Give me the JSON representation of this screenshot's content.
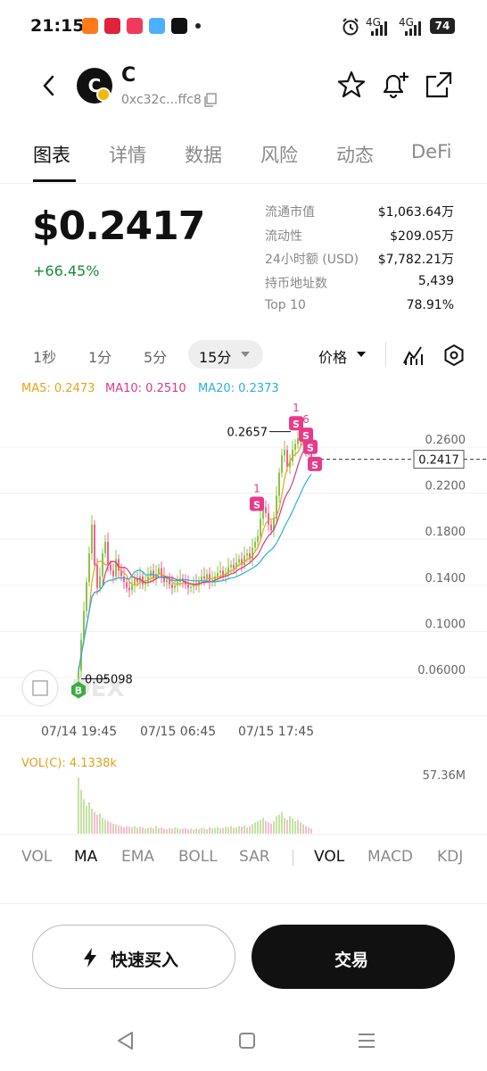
{
  "status_bar": {
    "time": "21:15",
    "network_1": "4G",
    "network_2": "4G",
    "battery": "74",
    "app_icons": [
      {
        "name": "app-icon-1",
        "color": "#ff7a1a"
      },
      {
        "name": "app-icon-2",
        "color": "#e0223a"
      },
      {
        "name": "app-icon-3",
        "color": "#f03a5a"
      },
      {
        "name": "app-icon-4",
        "color": "#4db0ff"
      },
      {
        "name": "tiktok-icon",
        "color": "#111111"
      }
    ]
  },
  "header": {
    "token_symbol": "C",
    "token_initial": "C",
    "address": "0xc32c...ffc8"
  },
  "tabs": [
    "图表",
    "详情",
    "数据",
    "风险",
    "动态",
    "DeFi"
  ],
  "price": {
    "value": "$0.2417",
    "change": "+66.45%",
    "change_color": "#1a8a3a"
  },
  "stats": [
    {
      "label": "流通市值",
      "value": "$1,063.64万"
    },
    {
      "label": "流动性",
      "value": "$209.05万"
    },
    {
      "label": "24小时额 (USD)",
      "value": "$7,782.21万"
    },
    {
      "label": "持币地址数",
      "value": "5,439"
    },
    {
      "label": "Top 10",
      "value": "78.91%"
    }
  ],
  "intervals": [
    "1秒",
    "1分",
    "5分"
  ],
  "active_interval": "15分",
  "price_type": "价格",
  "ma_legend": [
    {
      "label": "MA5: 0.2473",
      "color": "#e8a317"
    },
    {
      "label": "MA10: 0.2510",
      "color": "#d63a8a"
    },
    {
      "label": "MA20: 0.2373",
      "color": "#2bb0d8"
    }
  ],
  "chart_data": {
    "type": "candlestick",
    "y_ticks": [
      "0.2600",
      "0.2200",
      "0.1800",
      "0.1400",
      "0.1000",
      "0.06000"
    ],
    "y_tick_values": [
      0.26,
      0.22,
      0.18,
      0.14,
      0.1,
      0.06
    ],
    "x_ticks": [
      "07/14 19:45",
      "07/15 06:45",
      "07/15 17:45"
    ],
    "current_price": "0.2417",
    "current_price_value": 0.2417,
    "high_label": "0.2657",
    "high_value": 0.2657,
    "low_label": "0.05098",
    "low_value": 0.05098,
    "watermark": "DEX",
    "candles_close": [
      0.058,
      0.085,
      0.11,
      0.135,
      0.16,
      0.185,
      0.15,
      0.13,
      0.14,
      0.16,
      0.17,
      0.15,
      0.145,
      0.14,
      0.155,
      0.145,
      0.14,
      0.135,
      0.13,
      0.128,
      0.132,
      0.138,
      0.135,
      0.14,
      0.133,
      0.135,
      0.14,
      0.145,
      0.138,
      0.142,
      0.147,
      0.14,
      0.135,
      0.137,
      0.133,
      0.13,
      0.132,
      0.135,
      0.138,
      0.136,
      0.133,
      0.13,
      0.131,
      0.134,
      0.132,
      0.136,
      0.14,
      0.138,
      0.142,
      0.135,
      0.137,
      0.14,
      0.143,
      0.145,
      0.14,
      0.142,
      0.148,
      0.15,
      0.147,
      0.152,
      0.155,
      0.15,
      0.158,
      0.16,
      0.155,
      0.165,
      0.17,
      0.175,
      0.19,
      0.2,
      0.195,
      0.185,
      0.18,
      0.19,
      0.21,
      0.23,
      0.245,
      0.25,
      0.235,
      0.24,
      0.25,
      0.255,
      0.26,
      0.258,
      0.262,
      0.25,
      0.248,
      0.2417
    ],
    "markers": [
      {
        "label": "B",
        "color": "#3cae3c",
        "candle": 0
      },
      {
        "label": "S",
        "color": "#e83a8a",
        "candle": 68,
        "count": "1"
      },
      {
        "label": "S",
        "color": "#e83a8a",
        "candle": 82,
        "count": "1"
      },
      {
        "label": "S",
        "color": "#e83a8a",
        "candle": 85,
        "count": "6"
      },
      {
        "label": "S",
        "color": "#e83a8a",
        "candle": 86
      },
      {
        "label": "S",
        "color": "#e83a8a",
        "candle": 87
      }
    ]
  },
  "volume": {
    "label": "VOL(C): 4.1338k",
    "max": "57.36M",
    "values": [
      0.9,
      0.7,
      0.55,
      0.45,
      0.5,
      0.4,
      0.35,
      0.3,
      0.32,
      0.25,
      0.22,
      0.2,
      0.18,
      0.16,
      0.15,
      0.13,
      0.12,
      0.1,
      0.12,
      0.11,
      0.1,
      0.12,
      0.09,
      0.11,
      0.1,
      0.08,
      0.09,
      0.1,
      0.08,
      0.12,
      0.09,
      0.1,
      0.08,
      0.07,
      0.09,
      0.08,
      0.1,
      0.09,
      0.07,
      0.08,
      0.09,
      0.07,
      0.08,
      0.06,
      0.08,
      0.07,
      0.09,
      0.08,
      0.07,
      0.1,
      0.08,
      0.09,
      0.1,
      0.08,
      0.09,
      0.11,
      0.1,
      0.12,
      0.09,
      0.1,
      0.12,
      0.11,
      0.13,
      0.1,
      0.12,
      0.15,
      0.18,
      0.2,
      0.22,
      0.25,
      0.2,
      0.18,
      0.16,
      0.2,
      0.28,
      0.3,
      0.35,
      0.25,
      0.22,
      0.28,
      0.24,
      0.2,
      0.22,
      0.18,
      0.15,
      0.12,
      0.1,
      0.08
    ]
  },
  "indicator_tabs": {
    "main": [
      "VOL",
      "MA",
      "EMA",
      "BOLL",
      "SAR"
    ],
    "main_active": "MA",
    "sub": [
      "VOL",
      "MACD",
      "KDJ"
    ],
    "sub_active": "VOL"
  },
  "buttons": {
    "quick_buy": "快速买入",
    "trade": "交易"
  }
}
